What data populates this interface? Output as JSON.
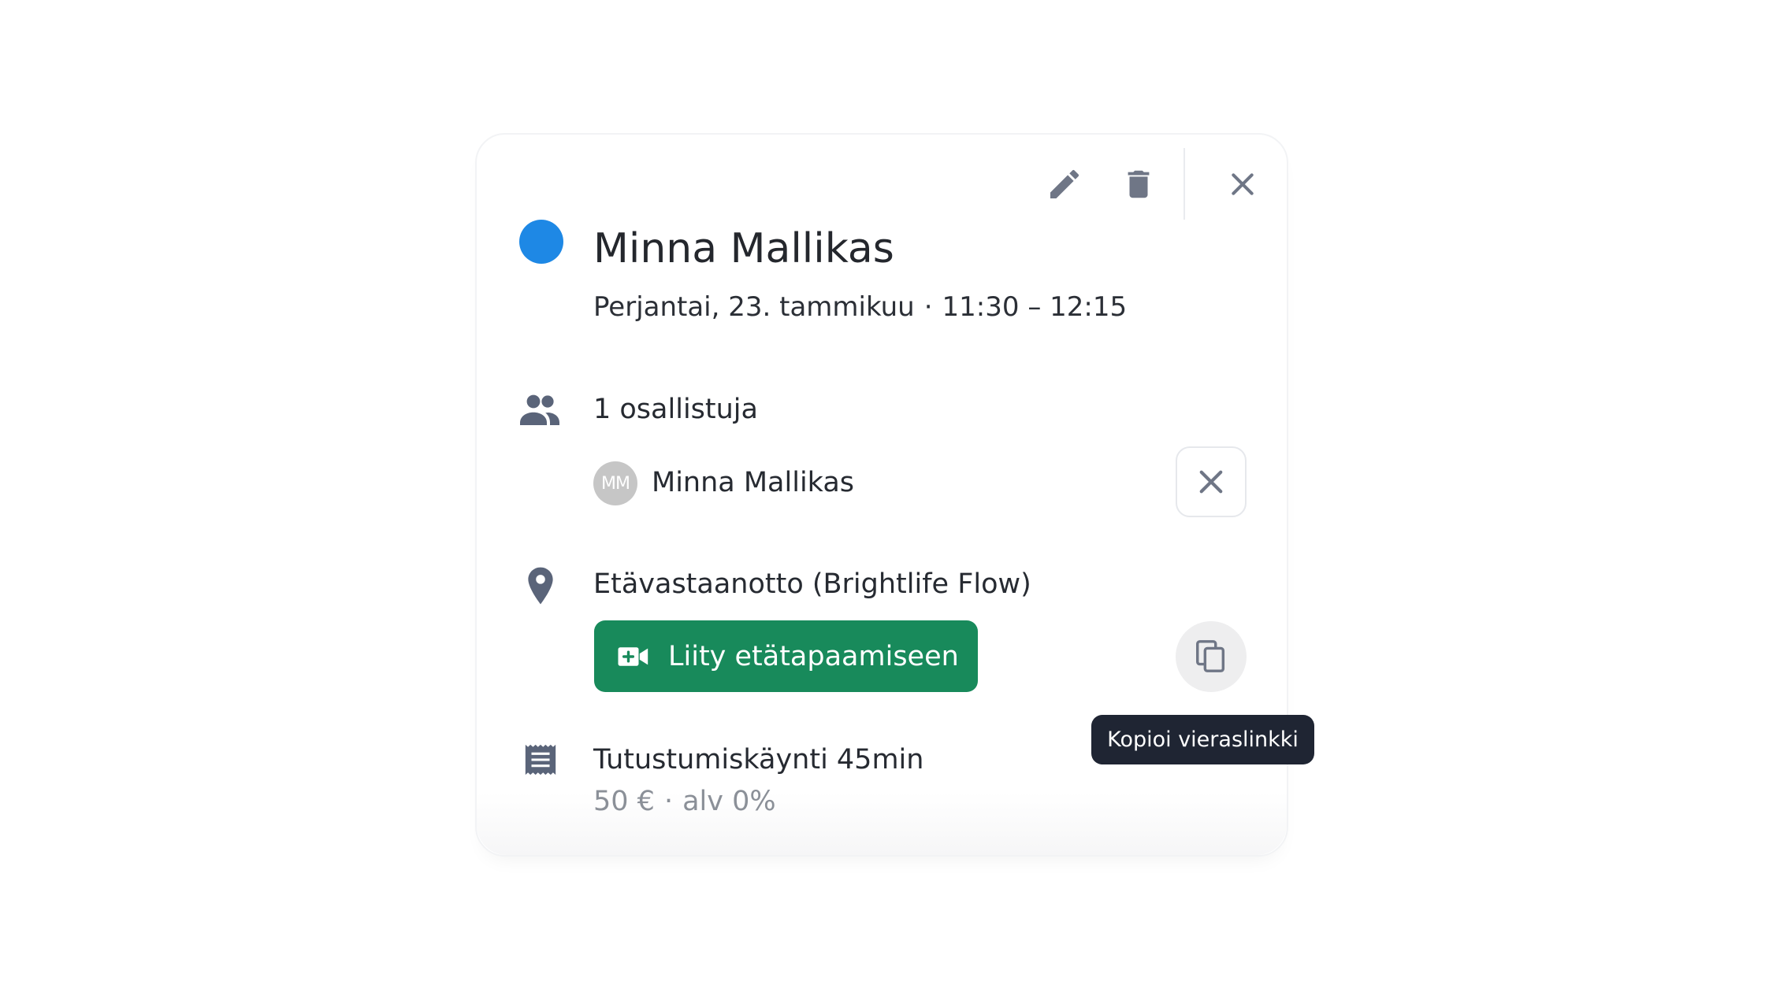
{
  "colors": {
    "event_dot": "#1e88e5",
    "join_button": "#188a5b",
    "tooltip_bg": "#1f2533",
    "icon": "#6f7686",
    "section_icon": "#5a6479"
  },
  "toolbar": {
    "edit_icon": "pencil-icon",
    "delete_icon": "trash-icon",
    "close_icon": "close-icon"
  },
  "event": {
    "title": "Minna Mallikas",
    "date": "Perjantai, 23. tammikuu",
    "separator": "·",
    "time": "11:30 – 12:15"
  },
  "participants": {
    "icon": "people-icon",
    "count_label": "1 osallistuja",
    "items": [
      {
        "initials": "MM",
        "name": "Minna Mallikas",
        "remove_icon": "close-icon"
      }
    ]
  },
  "location": {
    "icon": "location-pin-icon",
    "label": "Etävastaanotto (Brightlife Flow)",
    "join_button_label": "Liity etätapaamiseen",
    "join_icon": "video-plus-icon",
    "copy_icon": "copy-icon",
    "copy_tooltip": "Kopioi vieraslinkki"
  },
  "service": {
    "icon": "receipt-icon",
    "name": "Tutustumiskäynti 45min",
    "price": "50 €",
    "separator": "·",
    "vat": "alv 0%"
  }
}
